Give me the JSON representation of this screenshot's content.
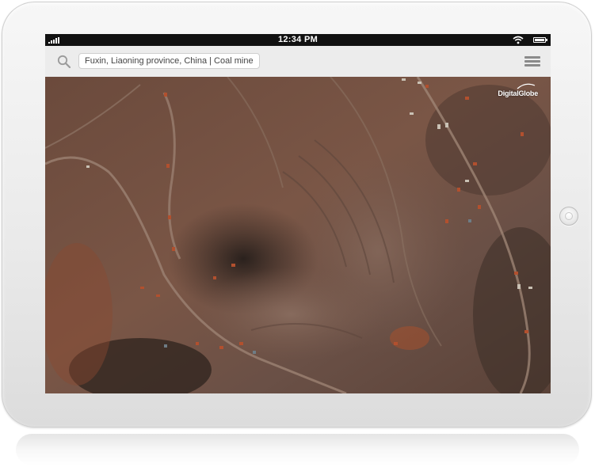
{
  "status_bar": {
    "time": "12:34 PM",
    "icons": [
      "signal-icon",
      "wifi-icon",
      "battery-icon"
    ]
  },
  "search": {
    "icon": "search-icon",
    "value": "Fuxin, Liaoning province, China | Coal mine"
  },
  "menu": {
    "icon": "hamburger-menu-icon"
  },
  "map": {
    "credit": "DigitalGlobe"
  },
  "device": {
    "home_button": "home-button"
  }
}
